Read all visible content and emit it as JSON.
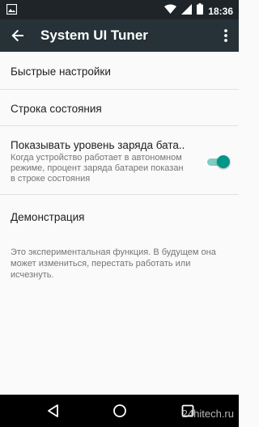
{
  "status_bar": {
    "time": "18:36",
    "left_icon": "image-icon",
    "icons": [
      "wifi-icon",
      "signal-icon",
      "battery-icon"
    ]
  },
  "app_bar": {
    "title": "System UI Tuner",
    "back_icon": "arrow-back-icon",
    "menu_icon": "more-vert-icon"
  },
  "preferences": [
    {
      "title": "Быстрые настройки"
    },
    {
      "title": "Строка состояния"
    },
    {
      "title": "Показывать уровень заряда бата..",
      "summary": "Когда устройство работает в автономном режиме, процент заряда батареи показан в строке состояния",
      "toggle_on": true
    },
    {
      "title": "Демонстрация"
    }
  ],
  "footer_note": "Это экспериментальная функция. В будущем она может измениться, перестать работать или исчезнуть.",
  "nav_bar": {
    "icons": [
      "back-triangle-icon",
      "home-circle-icon",
      "recents-square-icon"
    ]
  },
  "watermark": "24hitech.ru",
  "colors": {
    "status_bar": "#1e2428",
    "app_bar": "#263238",
    "accent": "#009688",
    "background": "#fafafa"
  }
}
